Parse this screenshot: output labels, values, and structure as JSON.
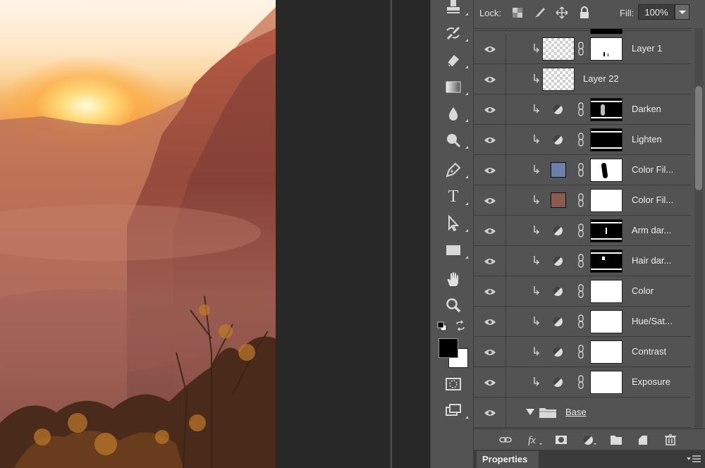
{
  "layers_panel": {
    "lock_label": "Lock:",
    "fill_label": "Fill:",
    "fill_value": "100%",
    "layers": [
      {
        "name": "Layer 1",
        "kind": "pixel-with-mask",
        "visible": true,
        "clipped": true
      },
      {
        "name": "Layer 22",
        "kind": "pixel",
        "visible": true,
        "clipped": true
      },
      {
        "name": "Darken",
        "kind": "adjustment",
        "visible": true,
        "clipped": true
      },
      {
        "name": "Lighten",
        "kind": "adjustment",
        "visible": true,
        "clipped": true
      },
      {
        "name": "Color Fil...",
        "kind": "fill",
        "fill_color": "#6d7fa8",
        "visible": true,
        "clipped": true
      },
      {
        "name": "Color Fil...",
        "kind": "fill",
        "fill_color": "#8b5a50",
        "visible": true,
        "clipped": true
      },
      {
        "name": "Arm dar...",
        "kind": "adjustment",
        "visible": true,
        "clipped": true
      },
      {
        "name": "Hair dar...",
        "kind": "adjustment",
        "visible": true,
        "clipped": true
      },
      {
        "name": "Color",
        "kind": "adjustment",
        "visible": true,
        "clipped": true
      },
      {
        "name": "Hue/Sat...",
        "kind": "adjustment",
        "visible": true,
        "clipped": true
      },
      {
        "name": "Contrast",
        "kind": "adjustment",
        "visible": true,
        "clipped": true
      },
      {
        "name": "Exposure",
        "kind": "adjustment",
        "visible": true,
        "clipped": true
      },
      {
        "name": "Base",
        "kind": "group",
        "visible": true,
        "expanded": true
      }
    ],
    "bottom_icons": [
      "link-icon",
      "fx-icon",
      "add-mask-icon",
      "adjustment-icon",
      "new-group-icon",
      "new-layer-icon",
      "trash-icon"
    ],
    "properties_tab": "Properties"
  },
  "tools": [
    "stamp-tool-icon",
    "history-brush-icon",
    "eraser-icon",
    "gradient-icon",
    "blur-icon",
    "dodge-icon",
    "pen-icon",
    "text-icon",
    "path-select-icon",
    "rectangle-icon",
    "hand-icon",
    "zoom-icon",
    "quick-mask-icon",
    "screen-mode-icon"
  ],
  "colors": {
    "foreground": "#000000",
    "background": "#ffffff",
    "panel": "#535353",
    "pasteboard": "#282828"
  }
}
